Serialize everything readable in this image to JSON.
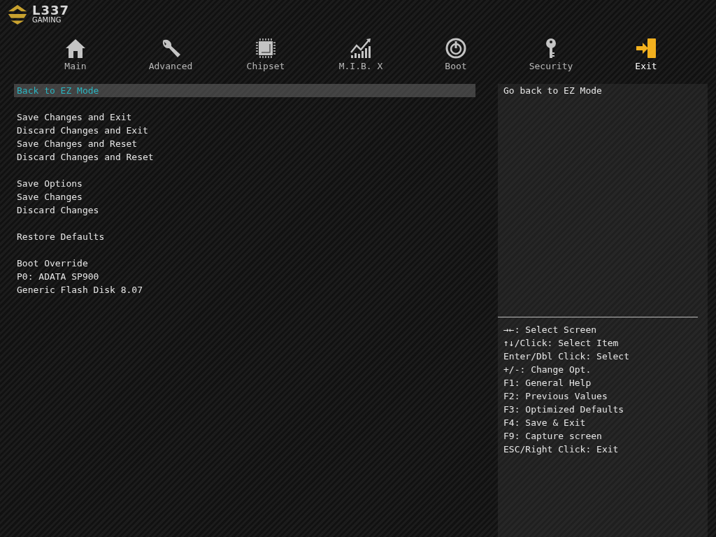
{
  "logo": {
    "name": "L337",
    "subtitle": "GAMING"
  },
  "tabs": [
    {
      "label": "Main",
      "kind": "home",
      "selected": false
    },
    {
      "label": "Advanced",
      "kind": "wrench",
      "selected": false
    },
    {
      "label": "Chipset",
      "kind": "chip",
      "selected": false
    },
    {
      "label": "M.I.B. X",
      "kind": "chart",
      "selected": false
    },
    {
      "label": "Boot",
      "kind": "power",
      "selected": false
    },
    {
      "label": "Security",
      "kind": "key",
      "selected": false
    },
    {
      "label": "Exit",
      "kind": "exit",
      "selected": true
    }
  ],
  "menu_groups": [
    {
      "items": [
        {
          "label": "Back to EZ Mode",
          "selected": true
        }
      ]
    },
    {
      "items": [
        {
          "label": "Save Changes and Exit",
          "selected": false
        },
        {
          "label": "Discard Changes and Exit",
          "selected": false
        },
        {
          "label": "Save Changes and Reset",
          "selected": false
        },
        {
          "label": "Discard Changes and Reset",
          "selected": false
        }
      ]
    },
    {
      "items": [
        {
          "label": "Save Options",
          "selected": false
        },
        {
          "label": "Save Changes",
          "selected": false
        },
        {
          "label": "Discard Changes",
          "selected": false
        }
      ]
    },
    {
      "items": [
        {
          "label": "Restore Defaults",
          "selected": false
        }
      ]
    },
    {
      "items": [
        {
          "label": "Boot Override",
          "selected": false
        },
        {
          "label": "P0: ADATA SP900",
          "selected": false
        },
        {
          "label": "Generic Flash Disk 8.07",
          "selected": false
        }
      ]
    }
  ],
  "help_text": "Go back to EZ Mode",
  "key_hints": [
    "→←: Select Screen",
    "↑↓/Click: Select Item",
    "Enter/Dbl Click: Select",
    "+/-: Change Opt.",
    "F1: General Help",
    "F2: Previous Values",
    "F3: Optimized Defaults",
    "F4: Save & Exit",
    "F9: Capture screen",
    "ESC/Right Click: Exit"
  ]
}
